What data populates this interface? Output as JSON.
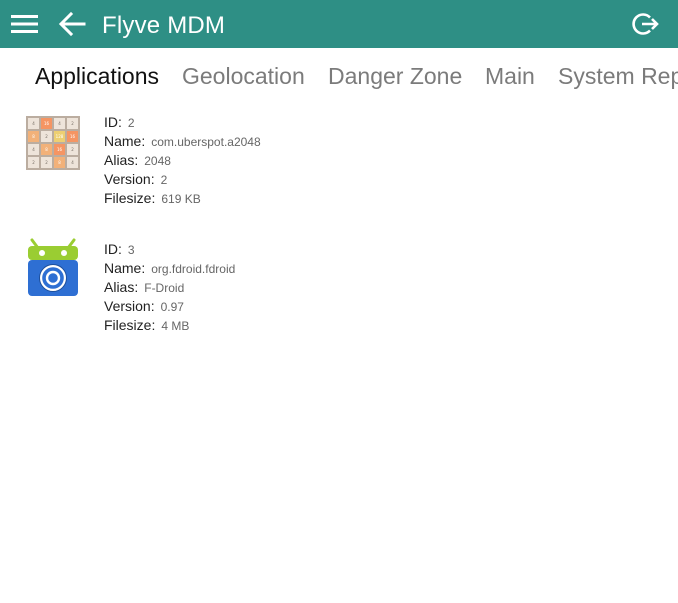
{
  "appbar": {
    "title": "Flyve MDM",
    "menu_icon": "hamburger-menu-icon",
    "back_icon": "arrow-left-icon",
    "logout_icon": "logout-icon"
  },
  "tabs": [
    {
      "label": "Applications",
      "active": true
    },
    {
      "label": "Geolocation",
      "active": false
    },
    {
      "label": "Danger Zone",
      "active": false
    },
    {
      "label": "Main",
      "active": false
    },
    {
      "label": "System Rep",
      "active": false
    }
  ],
  "field_labels": {
    "id": "ID:",
    "name": "Name:",
    "alias": "Alias:",
    "version": "Version:",
    "filesize": "Filesize:"
  },
  "applications": [
    {
      "icon": "2048-game-icon",
      "id": "2",
      "name": "com.uberspot.a2048",
      "alias": "2048",
      "version": "2",
      "filesize": "619 KB"
    },
    {
      "icon": "fdroid-icon",
      "id": "3",
      "name": "org.fdroid.fdroid",
      "alias": "F-Droid",
      "version": "0.97",
      "filesize": "4 MB"
    }
  ],
  "colors": {
    "appbar": "#2e8f85",
    "tab_active": "#111111",
    "tab_inactive": "#7b7b7b"
  }
}
